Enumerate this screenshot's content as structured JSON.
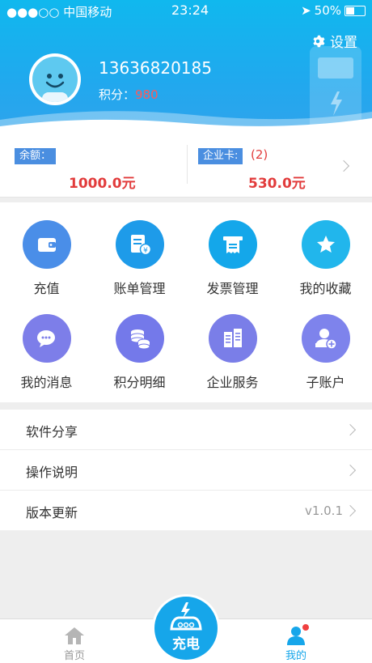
{
  "status_bar": {
    "carrier": "●●●○○ 中国移动",
    "time": "23:24",
    "battery": "50%",
    "battery_level": 0.5
  },
  "header": {
    "settings_label": "设置",
    "phone": "13636820185",
    "points_label": "积分：",
    "points_value": "980"
  },
  "balance": {
    "label": "余额：",
    "amount": "1000.0元",
    "card_label": "企业卡:",
    "card_count": "(2)",
    "card_amount": "530.0元"
  },
  "grid": {
    "items": [
      {
        "label": "充值",
        "icon": "wallet-icon",
        "color": "#4a8ee8"
      },
      {
        "label": "账单管理",
        "icon": "bill-icon",
        "color": "#1e9be9"
      },
      {
        "label": "发票管理",
        "icon": "invoice-icon",
        "color": "#14a7ea"
      },
      {
        "label": "我的收藏",
        "icon": "star-icon",
        "color": "#21b6ec"
      },
      {
        "label": "我的消息",
        "icon": "message-icon",
        "color": "#7d7ee9"
      },
      {
        "label": "积分明细",
        "icon": "coins-icon",
        "color": "#7479ea"
      },
      {
        "label": "企业服务",
        "icon": "building-icon",
        "color": "#7a7ee8"
      },
      {
        "label": "子账户",
        "icon": "add-user-icon",
        "color": "#7e83ec"
      }
    ]
  },
  "list": {
    "items": [
      {
        "label": "软件分享"
      },
      {
        "label": "操作说明"
      },
      {
        "label": "版本更新",
        "value": "v1.0.1"
      }
    ]
  },
  "tabbar": {
    "home": "首页",
    "charge": "充电",
    "mine": "我的",
    "active_color": "#16a6ea",
    "inactive_color": "#999999",
    "badge_color": "#f04040"
  }
}
